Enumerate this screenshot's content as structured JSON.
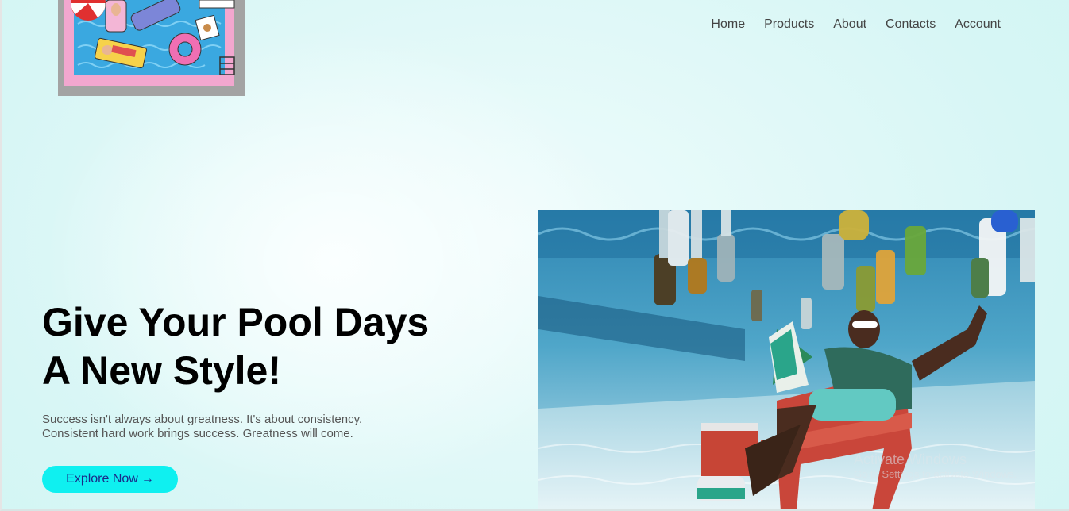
{
  "nav": {
    "items": [
      {
        "label": "Home"
      },
      {
        "label": "Products"
      },
      {
        "label": "About"
      },
      {
        "label": "Contacts"
      },
      {
        "label": "Account"
      }
    ]
  },
  "hero": {
    "title_line1": "Give Your Pool Days",
    "title_line2": "A New Style!",
    "subtitle_line1": "Success isn't always about greatness. It's about consistency.",
    "subtitle_line2": "Consistent hard work brings success. Greatness will come.",
    "cta_label": "Explore Now",
    "cta_arrow": "→"
  },
  "watermark": {
    "title": "Activate Windows",
    "subtitle": "Go to Settings to activate Windows."
  },
  "colors": {
    "accent": "#0ff0f0",
    "cta_text": "#1b2a88",
    "background": "#d7f6f5"
  },
  "icons": {
    "cta_arrow": "right-arrow-icon",
    "logo": "pool-illustration-logo",
    "hero_image": "underwater-pool-photo"
  }
}
